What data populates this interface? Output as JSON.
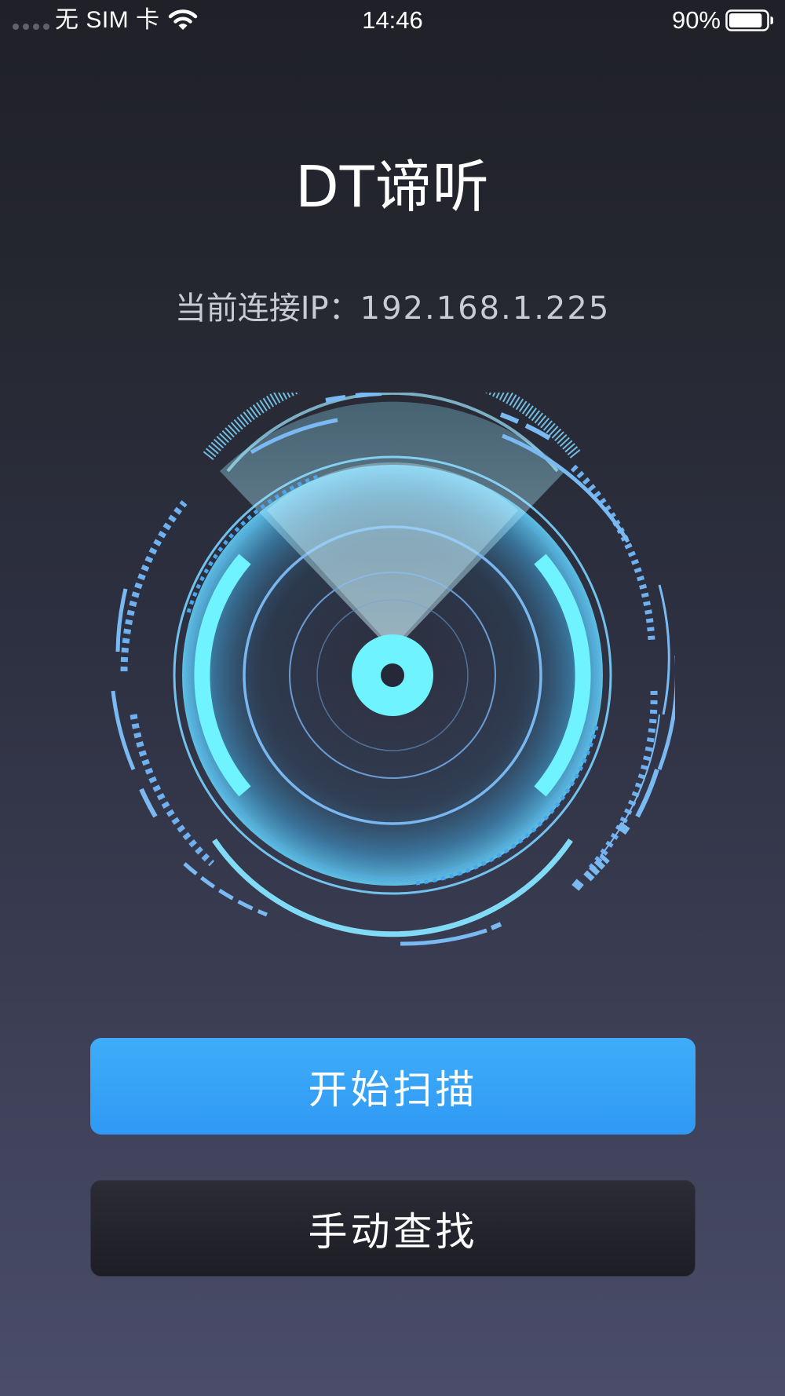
{
  "status_bar": {
    "carrier": "无 SIM 卡",
    "time": "14:46",
    "battery_percent": "90%",
    "battery_level": 0.9,
    "wifi_icon": "wifi-icon",
    "battery_icon": "battery-icon"
  },
  "header": {
    "title": "DT谛听"
  },
  "connection": {
    "label": "当前连接IP：",
    "ip": "192.168.1.225"
  },
  "radar": {
    "icon": "radar-icon",
    "accent_color": "#6ff3ff",
    "ring_color": "#6fa8e8"
  },
  "actions": {
    "start_scan": "开始扫描",
    "manual_search": "手动查找"
  },
  "colors": {
    "primary_button": "#35a2f6",
    "secondary_button": "#23242d",
    "background_top": "#1f2028",
    "background_bottom": "#4a4d6a"
  }
}
